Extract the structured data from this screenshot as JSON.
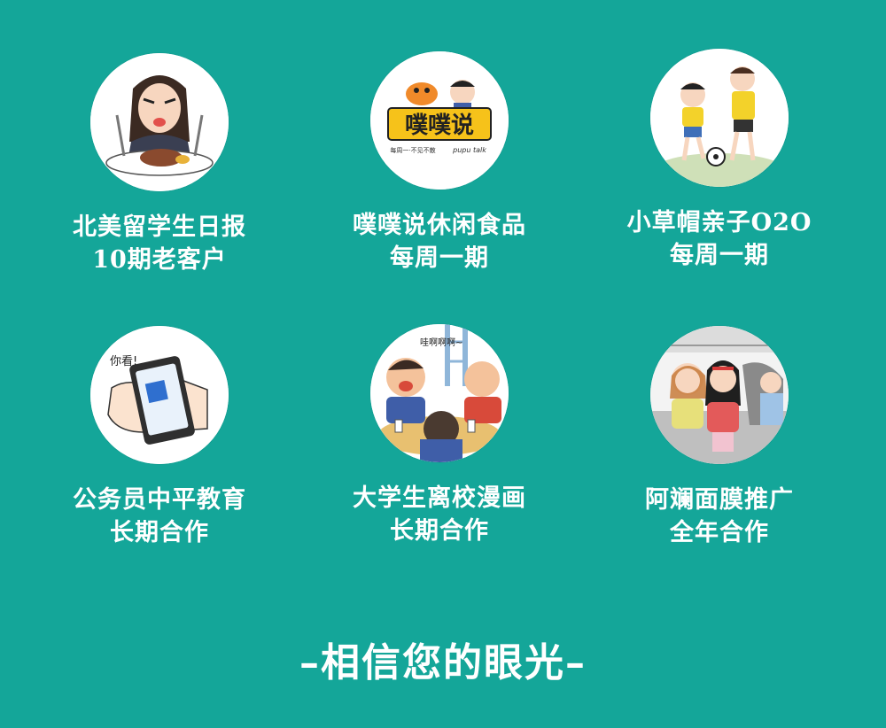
{
  "cards": [
    {
      "title": "北美留学生日报",
      "subtitle": "10期老客户",
      "icon": "girl-eating-steak-icon"
    },
    {
      "title": "噗噗说休闲食品",
      "subtitle": "每周一期",
      "icon": "pupu-talk-logo-icon",
      "logo_text": "噗噗说",
      "logo_sub": "每周一·不见不散",
      "logo_en": "pupu talk"
    },
    {
      "title": "小草帽亲子O2O",
      "subtitle": "每周一期",
      "icon": "father-son-soccer-icon"
    },
    {
      "title": "公务员中平教育",
      "subtitle": "长期合作",
      "icon": "phone-in-hand-icon",
      "bubble": "你看!"
    },
    {
      "title": "大学生离校漫画",
      "subtitle": "长期合作",
      "icon": "students-farewell-comic-icon",
      "bubble": "哇啊啊啊~"
    },
    {
      "title": "阿斓面膜推广",
      "subtitle": "全年合作",
      "icon": "girls-on-subway-icon"
    }
  ],
  "slogan": "–相信您的眼光–",
  "colors": {
    "background": "#14a699",
    "text": "#ffffff"
  }
}
